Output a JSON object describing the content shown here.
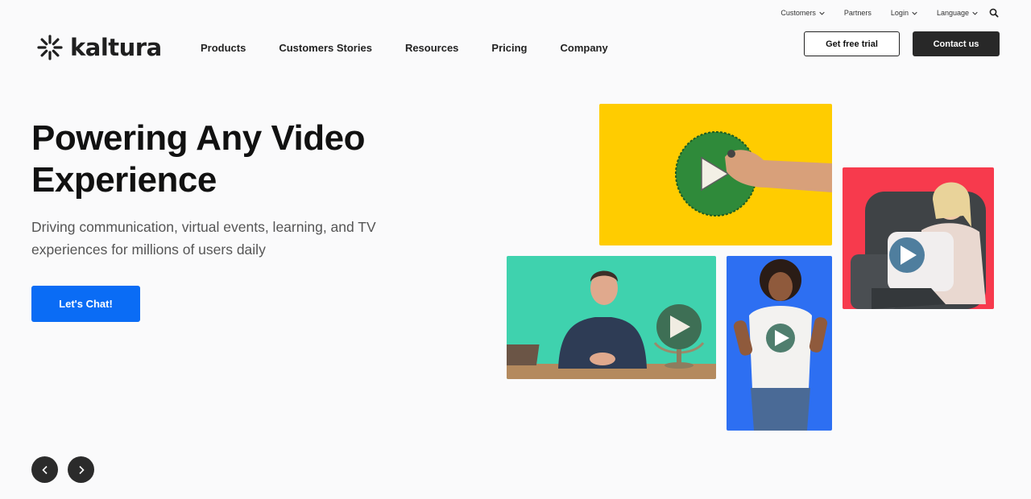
{
  "utility_nav": {
    "customers": "Customers",
    "partners": "Partners",
    "login": "Login",
    "language": "Language"
  },
  "brand": {
    "name": "kaltura"
  },
  "main_nav": {
    "items": [
      {
        "label": "Products"
      },
      {
        "label": "Customers Stories"
      },
      {
        "label": "Resources"
      },
      {
        "label": "Pricing"
      },
      {
        "label": "Company"
      }
    ]
  },
  "header_actions": {
    "trial_label": "Get free trial",
    "contact_label": "Contact us"
  },
  "hero": {
    "title_line1": "Powering Any Video",
    "title_line2": "Experience",
    "subtitle_line1": "Driving communication, virtual events, learning, and TV",
    "subtitle_line2": "experiences for millions of users daily",
    "cta_label": "Let's Chat!"
  },
  "colors": {
    "accent_blue": "#0a6cf5",
    "dark_button": "#282828",
    "tile_yellow": "#ffcc00",
    "tile_red": "#f73a4d",
    "tile_teal": "#3fd2ae",
    "tile_blue": "#2d6ff2"
  },
  "icons": {
    "logo": "kaltura-burst-icon",
    "search": "search-icon",
    "prev": "chevron-left-icon",
    "next": "chevron-right-icon",
    "play": "play-icon"
  }
}
